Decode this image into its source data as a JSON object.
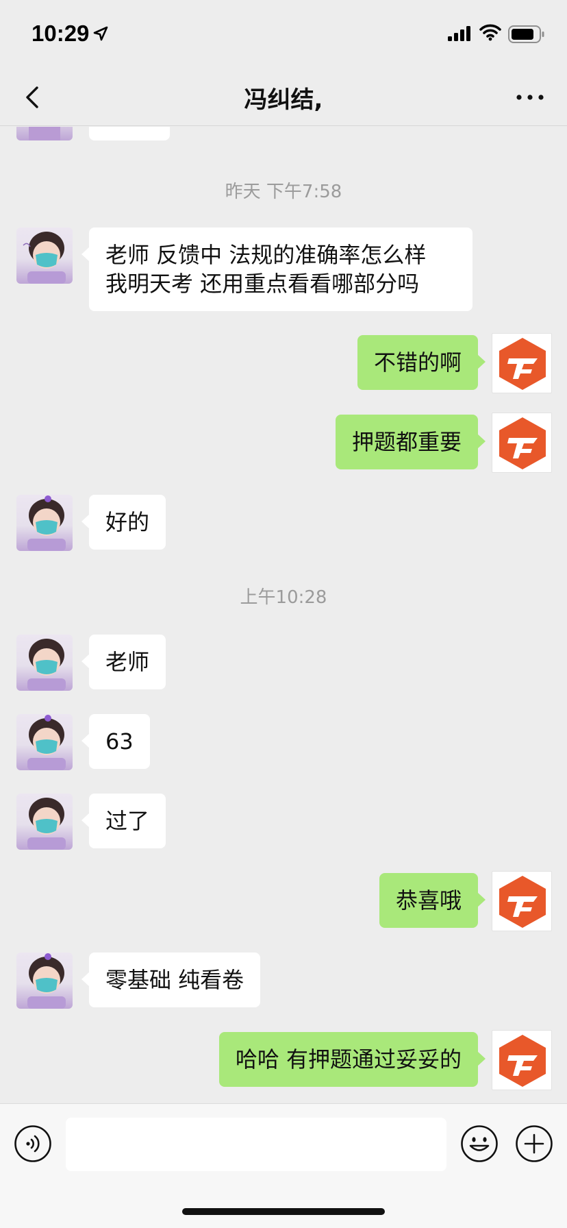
{
  "status_bar": {
    "time": "10:29",
    "location_icon": "location-arrow-icon",
    "signal_icon": "cellular-signal-icon",
    "wifi_icon": "wifi-icon",
    "battery_icon": "battery-icon"
  },
  "nav": {
    "back_icon": "chevron-left-icon",
    "title": "冯纠结,",
    "more_icon": "more-dots-icon"
  },
  "colors": {
    "background": "#ededed",
    "sent_bubble": "#a9e87a",
    "received_bubble": "#ffffff",
    "logo_orange": "#e8582a",
    "timestamp_text": "#9b9b9b"
  },
  "messages": {
    "ts1": "昨天 下午7:58",
    "m1_line1": "老师 反馈中 法规的准确率怎么样",
    "m1_line2": "我明天考 还用重点看看哪部分吗",
    "m2": "不错的啊",
    "m3": "押题都重要",
    "m4": "好的",
    "ts2": "上午10:28",
    "m5": "老师",
    "m6": "63",
    "m7": "过了",
    "m8": "恭喜哦",
    "m9": "零基础 纯看卷",
    "m10": "哈哈 有押题通过妥妥的"
  },
  "input_bar": {
    "voice_icon": "voice-icon",
    "text_value": "",
    "emoji_icon": "emoji-icon",
    "plus_icon": "plus-icon"
  }
}
